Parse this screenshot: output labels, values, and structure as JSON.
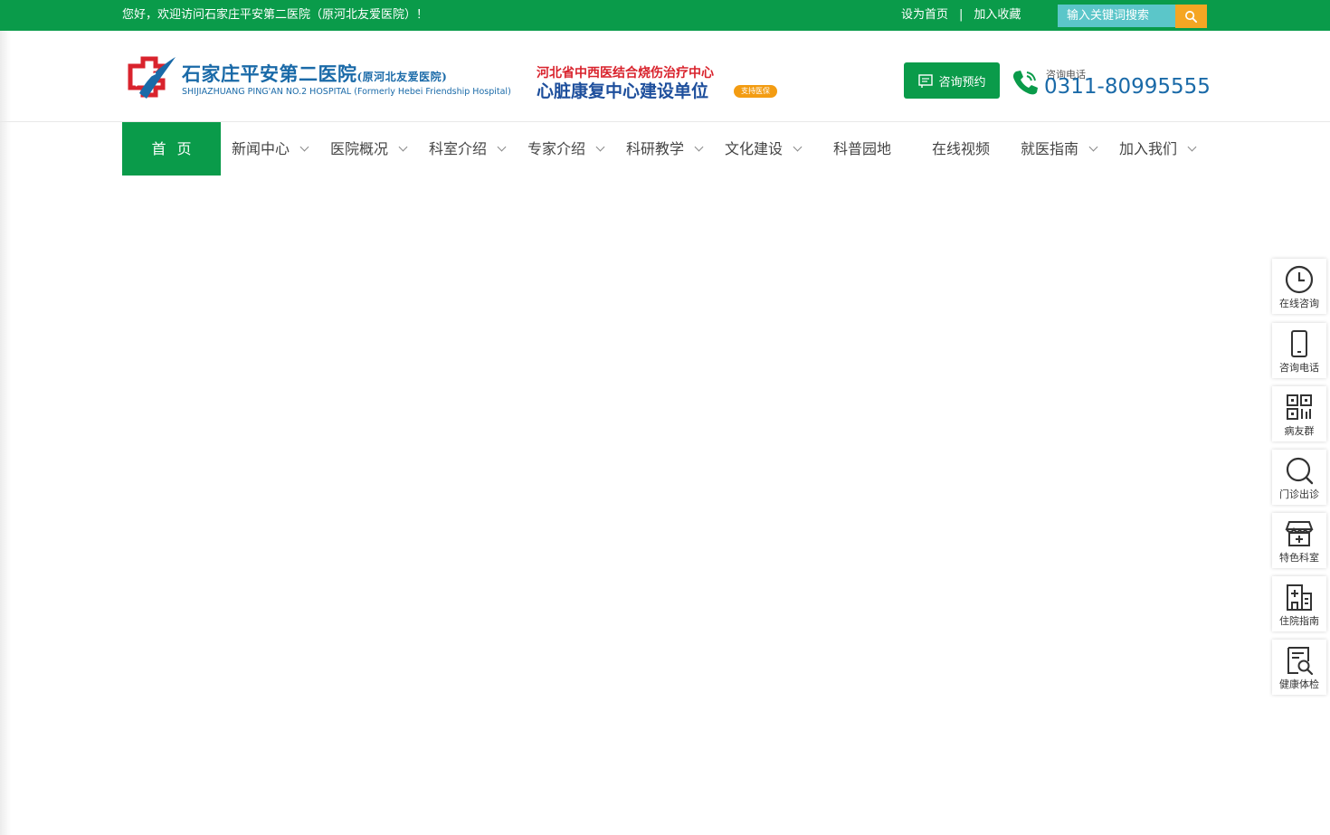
{
  "topbar": {
    "welcome": "您好，欢迎访问石家庄平安第二医院（原河北友爱医院）！",
    "set_home": "设为首页",
    "separator": "|",
    "add_favorite": "加入收藏",
    "search_placeholder": "输入关键词搜索",
    "search_icon": "search-icon"
  },
  "header": {
    "logo_cn": "石家庄平安第二医院",
    "logo_cn_sub": "(原河北友爱医院)",
    "logo_en": "SHIJIAZHUANG PING'AN NO.2 HOSPITAL (Formerly Hebei Friendship Hospital)",
    "slogan_line1": "河北省中西医结合烧伤治疗中心",
    "slogan_line2": "心脏康复中心建设单位",
    "badge": "支持医保",
    "consult_label": "咨询预约",
    "phone_label": "咨询电话",
    "phone_number": "0311-80995555"
  },
  "nav": {
    "items": [
      {
        "label": "首页",
        "dropdown": false
      },
      {
        "label": "新闻中心",
        "dropdown": true
      },
      {
        "label": "医院概况",
        "dropdown": true
      },
      {
        "label": "科室介绍",
        "dropdown": true
      },
      {
        "label": "专家介绍",
        "dropdown": true
      },
      {
        "label": "科研教学",
        "dropdown": true
      },
      {
        "label": "文化建设",
        "dropdown": true
      },
      {
        "label": "科普园地",
        "dropdown": false
      },
      {
        "label": "在线视频",
        "dropdown": false
      },
      {
        "label": "就医指南",
        "dropdown": true
      },
      {
        "label": "加入我们",
        "dropdown": true
      }
    ]
  },
  "side": {
    "items": [
      {
        "label": "在线咨询",
        "icon": "clock-icon"
      },
      {
        "label": "咨询电话",
        "icon": "mobile-icon"
      },
      {
        "label": "病友群",
        "icon": "qrcode-icon"
      },
      {
        "label": "门诊出诊",
        "icon": "search-icon"
      },
      {
        "label": "特色科室",
        "icon": "store-icon"
      },
      {
        "label": "住院指南",
        "icon": "hospital-icon"
      },
      {
        "label": "健康体检",
        "icon": "report-icon"
      }
    ]
  },
  "colors": {
    "brand_green": "#0a9b4a",
    "search_teal": "#5bc6c9",
    "search_orange": "#f5a623",
    "logo_blue": "#1a6aa8",
    "slogan_red": "#d9232d"
  }
}
